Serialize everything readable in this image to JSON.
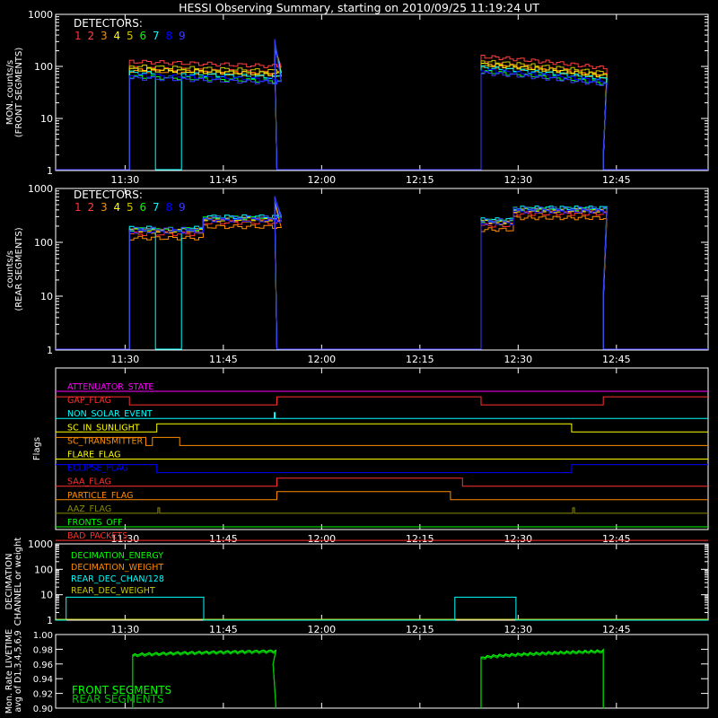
{
  "page": {
    "title": "HESSI Observing Summary, starting on 2010/09/25 11:19:24 UT"
  },
  "colors": {
    "axis": "#ffffff",
    "det": [
      "#ff3030",
      "#ff4040",
      "#ff8c00",
      "#ffff00",
      "#c8c800",
      "#00ff00",
      "#00ffff",
      "#0000ff",
      "#3c3cff"
    ],
    "flags": {
      "attenuator_state": "#ff00ff",
      "gap_flag": "#ff3030",
      "non_solar_event": "#00ffff",
      "sc_in_sunlight": "#ffff00",
      "sc_transmitter": "#ff8c00",
      "flare_flag": "#ffff00",
      "eclipse_flag": "#0000ff",
      "saa_flag": "#ff3030",
      "particle_flag": "#ff8c00",
      "aaz_flag": "#8c8c00",
      "fronts_off": "#00ff00",
      "bad_packets": "#ff3030"
    },
    "decimation": {
      "energy": "#00ff00",
      "weight": "#ff8c00",
      "chan": "#00ffff",
      "rear_weight": "#c8c800"
    },
    "livetime": {
      "front": "#00ff00",
      "rear": "#00c000"
    }
  },
  "chart_data": [
    {
      "id": "front",
      "type": "line",
      "title": "HESSI Observing Summary, starting on 2010/09/25 11:19:24 UT",
      "ylabel": [
        "MON. counts/s",
        "(FRONT SEGMENTS)"
      ],
      "yscale": "log",
      "ylim": [
        1,
        1000
      ],
      "yticks": [
        "1",
        "10",
        "100",
        "1000"
      ],
      "xlim": [
        "11:19:24",
        "12:59:00"
      ],
      "xticks": [
        "11:30",
        "11:45",
        "12:00",
        "12:15",
        "12:30",
        "12:45"
      ],
      "legend": {
        "title": "DETECTORS:",
        "labels": [
          "1",
          "2",
          "3",
          "4",
          "5",
          "6",
          "7",
          "8",
          "9"
        ],
        "placement": "top-left"
      },
      "orbits": [
        {
          "start": "11:30:40",
          "end": "11:53:10",
          "level_start": 80,
          "level_end": 65,
          "spike_time": "11:52:50",
          "spike_value": 280
        },
        {
          "start": "12:24:20",
          "end": "12:43:00",
          "level_start": 100,
          "level_end": 60,
          "spike_time": "12:43:00",
          "spike_value": 2
        }
      ],
      "series_factors": [
        1.15,
        1.55,
        1.05,
        1.1,
        1.25,
        0.8,
        0.95,
        0.85,
        0.75
      ],
      "det7_gaps": [
        [
          "11:34:10",
          "11:38:10"
        ]
      ]
    },
    {
      "id": "rear",
      "type": "line",
      "ylabel": [
        "counts/s",
        "(REAR SEGMENTS)"
      ],
      "yscale": "log",
      "ylim": [
        1,
        1000
      ],
      "yticks": [
        "1",
        "10",
        "100",
        "1000"
      ],
      "xlim": [
        "11:19:24",
        "12:59:00"
      ],
      "xticks": [
        "11:30",
        "11:45",
        "12:00",
        "12:15",
        "12:30",
        "12:45"
      ],
      "legend": {
        "title": "DETECTORS:",
        "labels": [
          "1",
          "2",
          "3",
          "4",
          "5",
          "6",
          "7",
          "8",
          "9"
        ],
        "placement": "top-left"
      },
      "orbits": [
        {
          "start": "11:30:40",
          "end": "11:53:10",
          "segments": [
            [
              "11:30:40",
              "11:41:50",
              160
            ],
            [
              "11:41:50",
              "11:53:10",
              260
            ]
          ],
          "spike_time": "11:52:50",
          "spike_value": 600
        },
        {
          "start": "12:24:20",
          "end": "12:43:00",
          "segments": [
            [
              "12:24:20",
              "12:28:50",
              230
            ],
            [
              "12:28:50",
              "12:43:00",
              380
            ]
          ],
          "spike_time": "12:43:00",
          "spike_value": 10
        }
      ],
      "series_factors": [
        0.9,
        1.0,
        0.75,
        1.05,
        1.0,
        1.1,
        1.15,
        1.0,
        1.1
      ],
      "det7_gaps": [
        [
          "11:34:10",
          "11:38:10"
        ]
      ]
    },
    {
      "id": "flags",
      "type": "line",
      "ylabel": [
        "Flags"
      ],
      "xlim": [
        "11:19:24",
        "12:59:00"
      ],
      "xticks": [
        "11:30",
        "11:45",
        "12:00",
        "12:15",
        "12:30",
        "12:45"
      ],
      "flags": [
        {
          "key": "attenuator_state",
          "label": "ATTENUATOR_STATE",
          "changes": []
        },
        {
          "key": "gap_flag",
          "label": "GAP_FLAG",
          "start_high": true,
          "changes": [
            "11:30:40",
            "11:53:10",
            "12:24:20",
            "12:43:00"
          ]
        },
        {
          "key": "non_solar_event",
          "label": "NON_SOLAR_EVENT",
          "changes": [],
          "pulse": "11:52:50"
        },
        {
          "key": "sc_in_sunlight",
          "label": "SC_IN_SUNLIGHT",
          "start_high": false,
          "changes": [
            "11:34:50",
            "12:38:10"
          ]
        },
        {
          "key": "sc_transmitter",
          "label": "SC_TRANSMITTER",
          "start_high": true,
          "changes": [
            "11:33:10",
            "11:34:10",
            "11:38:20"
          ]
        },
        {
          "key": "flare_flag",
          "label": "FLARE_FLAG",
          "changes": []
        },
        {
          "key": "eclipse_flag",
          "label": "ECLIPSE_FLAG",
          "start_high": true,
          "changes": [
            "11:34:50",
            "12:38:10"
          ]
        },
        {
          "key": "saa_flag",
          "label": "SAA_FLAG",
          "start_high": false,
          "changes": [
            "11:53:10",
            "12:21:30"
          ]
        },
        {
          "key": "particle_flag",
          "label": "PARTICLE_FLAG",
          "start_high": false,
          "changes": [
            "11:53:10",
            "12:19:40"
          ]
        },
        {
          "key": "aaz_flag",
          "label": "AAZ_FLAG",
          "changes": [],
          "pulses": [
            "11:35:00",
            "12:38:20"
          ]
        },
        {
          "key": "fronts_off",
          "label": "FRONTS_OFF",
          "changes": []
        },
        {
          "key": "bad_packets",
          "label": "BAD_PACKETS",
          "changes": []
        }
      ]
    },
    {
      "id": "decimation",
      "type": "line",
      "ylabel": [
        "DECIMATION",
        "CHANNEL or weight"
      ],
      "yscale": "log",
      "ylim": [
        1,
        1000
      ],
      "yticks": [
        "1",
        "10",
        "100",
        "1000"
      ],
      "xlim": [
        "11:19:24",
        "12:59:00"
      ],
      "xticks": [
        "11:30",
        "11:45",
        "12:00",
        "12:15",
        "12:30",
        "12:45"
      ],
      "legend": [
        "DECIMATION_ENERGY",
        "DECIMATION_WEIGHT",
        "REAR_DEC_CHAN/128",
        "REAR_DEC_WEIGHT"
      ],
      "chan_high": 8,
      "chan_low": 1,
      "chan_windows": [
        [
          "11:21:00",
          "11:42:00"
        ],
        [
          "12:20:20",
          "12:29:40"
        ]
      ]
    },
    {
      "id": "livetime",
      "type": "line",
      "ylabel": [
        "Mon. Rate LIVETIME",
        "avg of D1,3,4,5,6,9"
      ],
      "ylim": [
        0.9,
        1.0
      ],
      "yticks": [
        "0.90",
        "0.92",
        "0.94",
        "0.96",
        "0.98",
        "1.00"
      ],
      "xlim": [
        "11:19:24",
        "12:59:00"
      ],
      "legend": [
        "FRONT SEGMENTS",
        "REAR SEGMENTS"
      ],
      "orbits": [
        {
          "start": "11:31:10",
          "end": "11:53:00",
          "v_start": 0.972,
          "v_end": 0.978
        },
        {
          "start": "12:24:20",
          "end": "12:43:00",
          "v_start": 0.968,
          "v_end": 0.978
        }
      ]
    }
  ]
}
